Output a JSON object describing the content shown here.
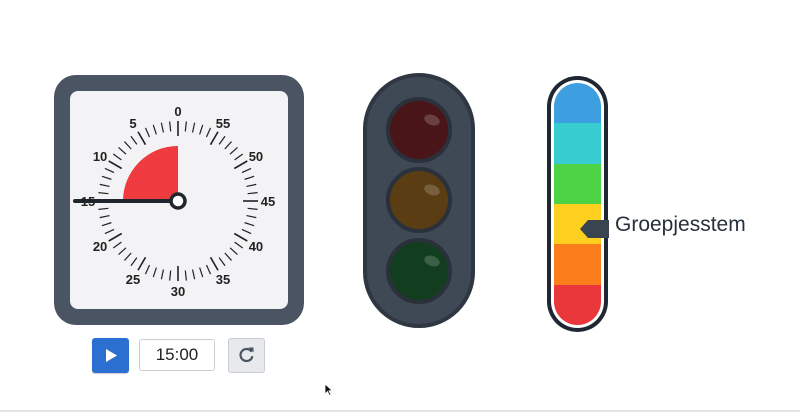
{
  "timer": {
    "dial_numbers": [
      "0",
      "5",
      "10",
      "15",
      "20",
      "25",
      "30",
      "35",
      "40",
      "45",
      "50",
      "55"
    ],
    "remaining_minutes": 15,
    "elapsed_color": "#ef3b40",
    "frame_color": "#4a5462"
  },
  "controls": {
    "play_icon": "play-icon",
    "time_value": "15:00",
    "reset_icon": "refresh-icon",
    "play_color": "#2b6fd1"
  },
  "traffic_light": {
    "lamps": [
      {
        "name": "red",
        "color": "#4a1518",
        "lit": false
      },
      {
        "name": "yellow",
        "color": "#5b3d14",
        "lit": false
      },
      {
        "name": "green",
        "color": "#123d1e",
        "lit": false
      }
    ]
  },
  "noise_meter": {
    "levels": [
      "#3d9fe0",
      "#37ccd0",
      "#4ed246",
      "#fdcf1e",
      "#fb7d1c",
      "#e9373b"
    ],
    "selected_level": 4,
    "label": "Groepjesstem"
  }
}
